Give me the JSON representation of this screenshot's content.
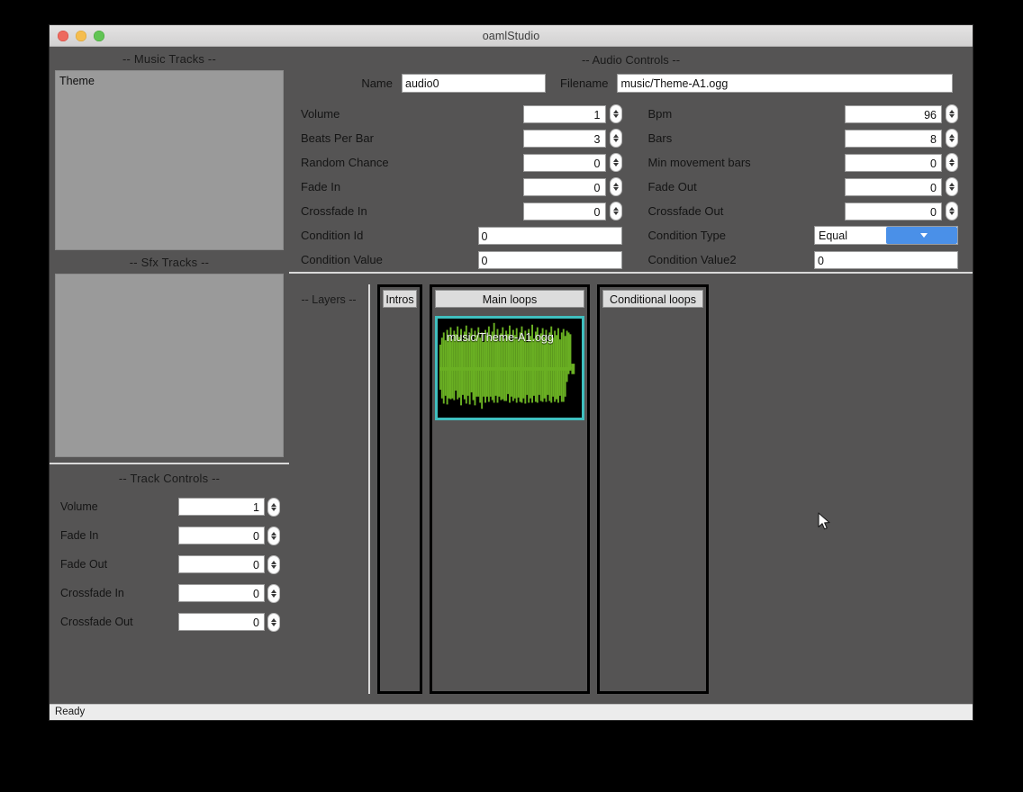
{
  "window": {
    "title": "oamlStudio",
    "status": "Ready"
  },
  "colors": {
    "panel_bg": "#555454",
    "list_bg": "#9a9a9a",
    "accent_select": "#4a90e8",
    "clip_border": "#3fbfbf",
    "waveform": "#6ab023",
    "clip_bg": "#000000",
    "tab_bg": "#dcdcdc",
    "statusbar_bg": "#ececec"
  },
  "music_tracks": {
    "title": "-- Music Tracks --",
    "items": [
      "Theme"
    ]
  },
  "sfx_tracks": {
    "title": "-- Sfx Tracks --",
    "items": []
  },
  "track_controls": {
    "title": "-- Track Controls --",
    "rows": [
      {
        "label": "Volume",
        "value": "1"
      },
      {
        "label": "Fade In",
        "value": "0"
      },
      {
        "label": "Fade Out",
        "value": "0"
      },
      {
        "label": "Crossfade In",
        "value": "0"
      },
      {
        "label": "Crossfade Out",
        "value": "0"
      }
    ]
  },
  "audio_controls": {
    "title": "-- Audio Controls --",
    "name_label": "Name",
    "name_value": "audio0",
    "filename_label": "Filename",
    "filename_value": "music/Theme-A1.ogg",
    "left_rows": [
      {
        "label": "Volume",
        "value": "1",
        "type": "spin"
      },
      {
        "label": "Beats Per Bar",
        "value": "3",
        "type": "spin"
      },
      {
        "label": "Random Chance",
        "value": "0",
        "type": "spin"
      },
      {
        "label": "Fade In",
        "value": "0",
        "type": "spin"
      },
      {
        "label": "Crossfade In",
        "value": "0",
        "type": "spin"
      },
      {
        "label": "Condition Id",
        "value": "0",
        "type": "text"
      },
      {
        "label": "Condition Value",
        "value": "0",
        "type": "text"
      }
    ],
    "right_rows": [
      {
        "label": "Bpm",
        "value": "96",
        "type": "spin"
      },
      {
        "label": "Bars",
        "value": "8",
        "type": "spin"
      },
      {
        "label": "Min movement bars",
        "value": "0",
        "type": "spin"
      },
      {
        "label": "Fade Out",
        "value": "0",
        "type": "spin"
      },
      {
        "label": "Crossfade Out",
        "value": "0",
        "type": "spin"
      },
      {
        "label": "Condition Type",
        "value": "Equal",
        "type": "select"
      },
      {
        "label": "Condition Value2",
        "value": "0",
        "type": "text"
      }
    ]
  },
  "layers": {
    "title": "-- Layers --",
    "columns": [
      {
        "header": "Intros",
        "clips": []
      },
      {
        "header": "Main loops",
        "clips": [
          {
            "label": "music/Theme-A1.ogg",
            "selected": true
          }
        ]
      },
      {
        "header": "Conditional loops",
        "clips": []
      }
    ]
  }
}
